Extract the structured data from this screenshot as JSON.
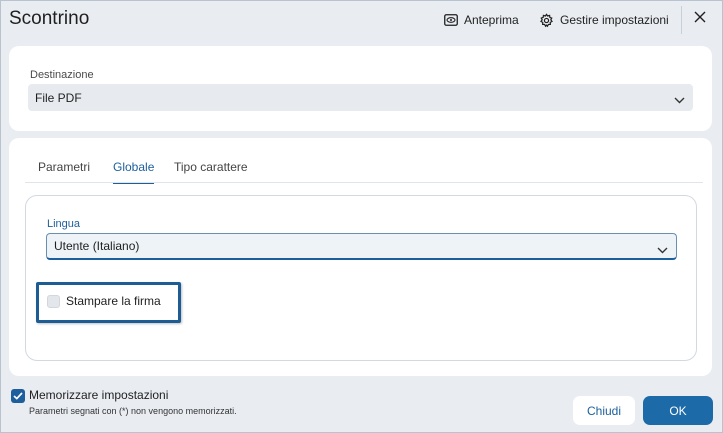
{
  "window": {
    "title": "Scontrino"
  },
  "toolbar": {
    "preview_label": "Anteprima",
    "preview_icon": "eye-icon",
    "settings_label": "Gestire impostazioni",
    "settings_icon": "gear-icon",
    "close_icon": "close-icon"
  },
  "destination": {
    "label": "Destinazione",
    "value": "File PDF"
  },
  "tabs": [
    {
      "label": "Parametri",
      "active": false
    },
    {
      "label": "Globale",
      "active": true
    },
    {
      "label": "Tipo carattere",
      "active": false
    }
  ],
  "globale": {
    "language_label": "Lingua",
    "language_value": "Utente (Italiano)",
    "print_signature_label": "Stampare la firma",
    "print_signature_checked": false
  },
  "footer": {
    "remember_label": "Memorizzare impostazioni",
    "remember_checked": true,
    "remember_note": "Parametri segnati con (*) non vengono memorizzati.",
    "close_label": "Chiudi",
    "ok_label": "OK"
  },
  "colors": {
    "accent": "#1d5f9c",
    "primary_button": "#1d6aa8",
    "background": "#e9edf2"
  }
}
